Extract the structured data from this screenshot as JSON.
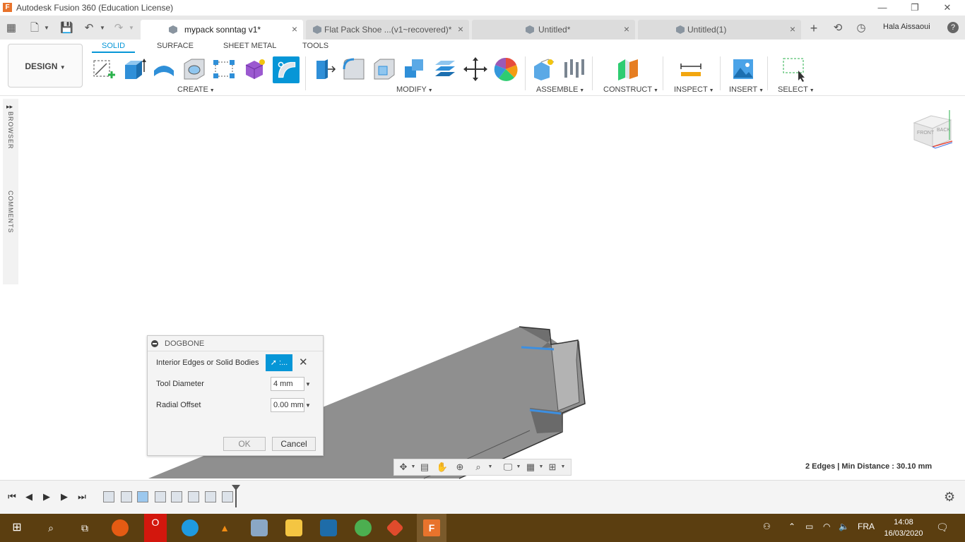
{
  "window": {
    "app_logo": "F",
    "title": "Autodesk Fusion 360 (Education License)",
    "minimize": "—",
    "restore": "❐",
    "close": "✕"
  },
  "tabs": [
    {
      "label": "mypack sonntag v1*",
      "active": true
    },
    {
      "label": "Flat Pack Shoe ...(v1~recovered)*",
      "active": false
    },
    {
      "label": "Untitled*",
      "active": false
    },
    {
      "label": "Untitled(1)",
      "active": false
    }
  ],
  "header": {
    "user": "Hala Aissaoui",
    "help": "?"
  },
  "workspace": {
    "label": "DESIGN"
  },
  "ribbon_tabs": [
    "SOLID",
    "SURFACE",
    "SHEET METAL",
    "TOOLS"
  ],
  "groups": {
    "create": "CREATE",
    "modify": "MODIFY",
    "assemble": "ASSEMBLE",
    "construct": "CONSTRUCT",
    "inspect": "INSPECT",
    "insert": "INSERT",
    "select": "SELECT"
  },
  "side_panel": {
    "browser": "BROWSER",
    "comments": "COMMENTS"
  },
  "viewcube": {
    "front": "FRONT",
    "back": "BACK"
  },
  "dialog": {
    "title": "DOGBONE",
    "edges_label": "Interior Edges or Solid Bodies",
    "select_label": ":...",
    "tool_diameter_label": "Tool Diameter",
    "tool_diameter_value": "4 mm",
    "radial_offset_label": "Radial Offset",
    "radial_offset_value": "0.00 mm",
    "ok": "OK",
    "cancel": "Cancel"
  },
  "status": {
    "text": "2 Edges | Min Distance : 30.10 mm"
  },
  "taskbar": {
    "language": "FRA",
    "time": "14:08",
    "date": "16/03/2020"
  },
  "colors": {
    "accent": "#0696d7",
    "taskbar": "#5b3e10",
    "body_fill": "#8f8f8f",
    "edge_highlight": "#3d8fe0"
  }
}
